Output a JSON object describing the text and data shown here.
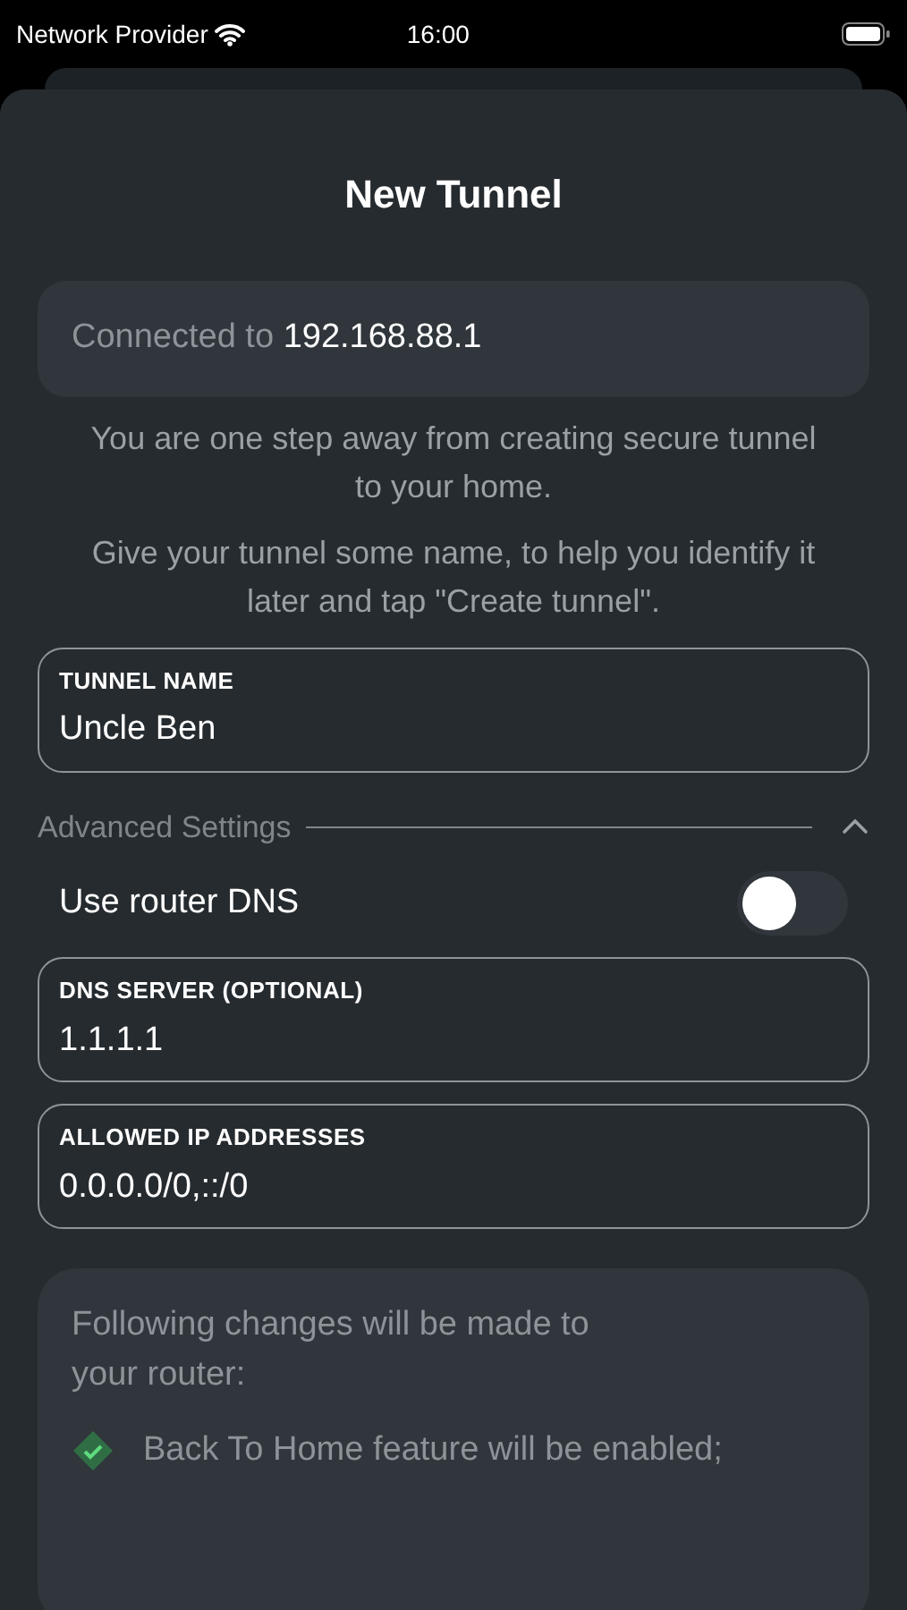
{
  "status_bar": {
    "carrier": "Network Provider",
    "time": "16:00"
  },
  "title": "New Tunnel",
  "connection": {
    "label": "Connected to",
    "address": "192.168.88.1"
  },
  "intro": [
    "You are one step away from creating secure tunnel to your home.",
    "Give your tunnel some name, to help you identify it later and tap \"Create tunnel\"."
  ],
  "tunnel_name": {
    "label": "TUNNEL NAME",
    "value": "Uncle Ben"
  },
  "advanced": {
    "label": "Advanced Settings",
    "expanded": true
  },
  "use_router_dns": {
    "label": "Use router DNS",
    "on": false
  },
  "fields": [
    {
      "label": "DNS SERVER (OPTIONAL)",
      "value": "1.1.1.1"
    },
    {
      "label": "ALLOWED IP ADDRESSES",
      "value": "0.0.0.0/0,::/0"
    }
  ],
  "changes": {
    "heading": "Following changes will be made to your router:",
    "items": [
      "Back To Home feature will be enabled;"
    ]
  }
}
